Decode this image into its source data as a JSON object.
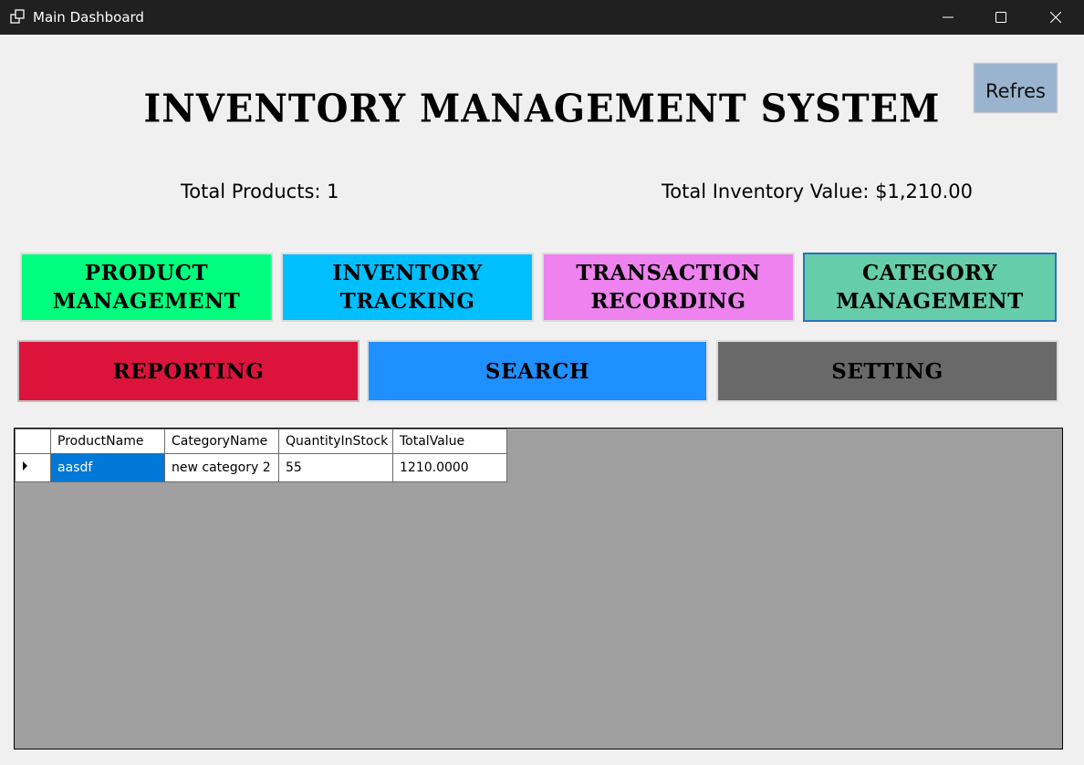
{
  "window": {
    "title": "Main Dashboard",
    "icons": [
      "app-icon",
      "minimize-icon",
      "maximize-icon",
      "close-icon"
    ]
  },
  "header": {
    "title": "INVENTORY MANAGEMENT SYSTEM",
    "refresh_label": "Refres"
  },
  "stats": {
    "total_products": "Total Products: 1",
    "total_value": "Total Inventory Value: $1,210.00"
  },
  "nav": {
    "product_management": {
      "line1": "PRODUCT",
      "line2": "MANAGEMENT",
      "color": "#00ff7f"
    },
    "inventory_tracking": {
      "line1": "INVENTORY",
      "line2": "TRACKING",
      "color": "#00bfff"
    },
    "transaction_recording": {
      "line1": "TRANSACTION",
      "line2": "RECORDING",
      "color": "#ee82ee"
    },
    "category_management": {
      "line1": "CATEGORY",
      "line2": "MANAGEMENT",
      "color": "#66cdaa"
    },
    "reporting": {
      "label": "REPORTING",
      "color": "#dc143c"
    },
    "search": {
      "label": "SEARCH",
      "color": "#1e90ff"
    },
    "setting": {
      "label": "SETTING",
      "color": "#696969"
    }
  },
  "grid": {
    "columns": [
      "ProductName",
      "CategoryName",
      "QuantityInStock",
      "TotalValue"
    ],
    "rows": [
      [
        "aasdf",
        "new category 2",
        "55",
        "1210.0000"
      ]
    ],
    "selection_color": "#0078d7",
    "background": "#a0a0a0"
  }
}
